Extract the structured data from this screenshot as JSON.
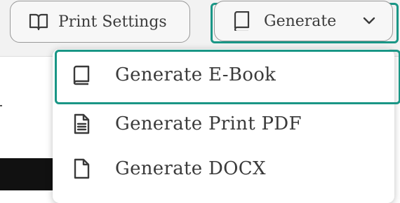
{
  "toolbar": {
    "print_settings_label": "Print Settings",
    "generate_label": "Generate"
  },
  "menu": {
    "items": [
      {
        "label": "Generate E-Book",
        "icon": "book-icon"
      },
      {
        "label": "Generate Print PDF",
        "icon": "document-text-icon"
      },
      {
        "label": "Generate DOCX",
        "icon": "document-icon"
      }
    ]
  },
  "colors": {
    "focus_ring": "#1a9686",
    "toolbar_bg": "#f2f2f2",
    "text": "#3a3a3a"
  }
}
